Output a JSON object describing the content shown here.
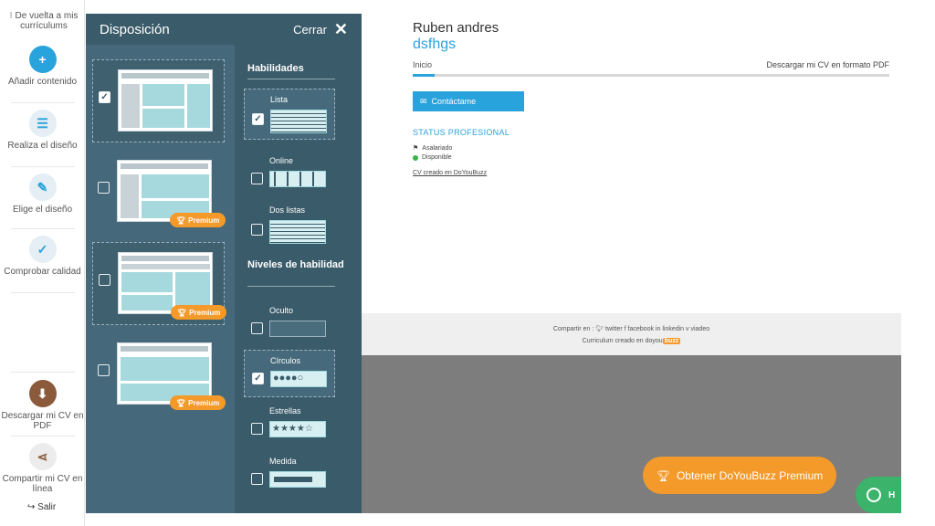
{
  "nav": {
    "back_label": "De vuelta a mis currículums",
    "items": [
      {
        "label": "Añadir contenido",
        "icon": "plus-icon"
      },
      {
        "label": "Realiza el diseño",
        "icon": "layout-icon"
      },
      {
        "label": "Elige el diseño",
        "icon": "pencil-icon"
      },
      {
        "label": "Comprobar calidad",
        "icon": "check-icon"
      }
    ],
    "download": {
      "label": "Descargar mi CV en PDF",
      "icon": "download-icon"
    },
    "share": {
      "label": "Compartir mi CV en línea",
      "icon": "share-icon"
    },
    "exit_label": "Salir"
  },
  "panel": {
    "title": "Disposición",
    "close_label": "Cerrar",
    "premium_badge": "Premium",
    "skills_title": "Habilidades",
    "skills_options": [
      "Lista",
      "Online",
      "Dos listas"
    ],
    "levels_title": "Niveles de habilidad",
    "levels_options": [
      "Oculto",
      "Círculos",
      "Estrellas",
      "Medida"
    ]
  },
  "cv": {
    "name": "Ruben andres",
    "title": "dsfhgs",
    "tab_home": "Inicio",
    "download_pdf": "Descargar mi CV en formato PDF",
    "contact_button": "Contáctame",
    "status_title": "STATUS PROFESIONAL",
    "status_1": "Asalariado",
    "status_2": "Disponible",
    "created_with": "CV creado en DoYouBuzz",
    "footer_share": "Compartir en :",
    "footer_twitter": "twitter",
    "footer_facebook": "facebook",
    "footer_linkedin": "linkedin",
    "footer_viadeo": "viadeo",
    "footer_created": "Curriculum creado en",
    "footer_brand_a": "do",
    "footer_brand_b": "you",
    "footer_brand_c": "buzz"
  },
  "premium_cta": "Obtener DoYouBuzz Premium",
  "help_label": "H",
  "colors": {
    "accent": "#29a3dc",
    "panel": "#3a5b6a",
    "premium": "#f39a2b",
    "help": "#3bb36b"
  }
}
